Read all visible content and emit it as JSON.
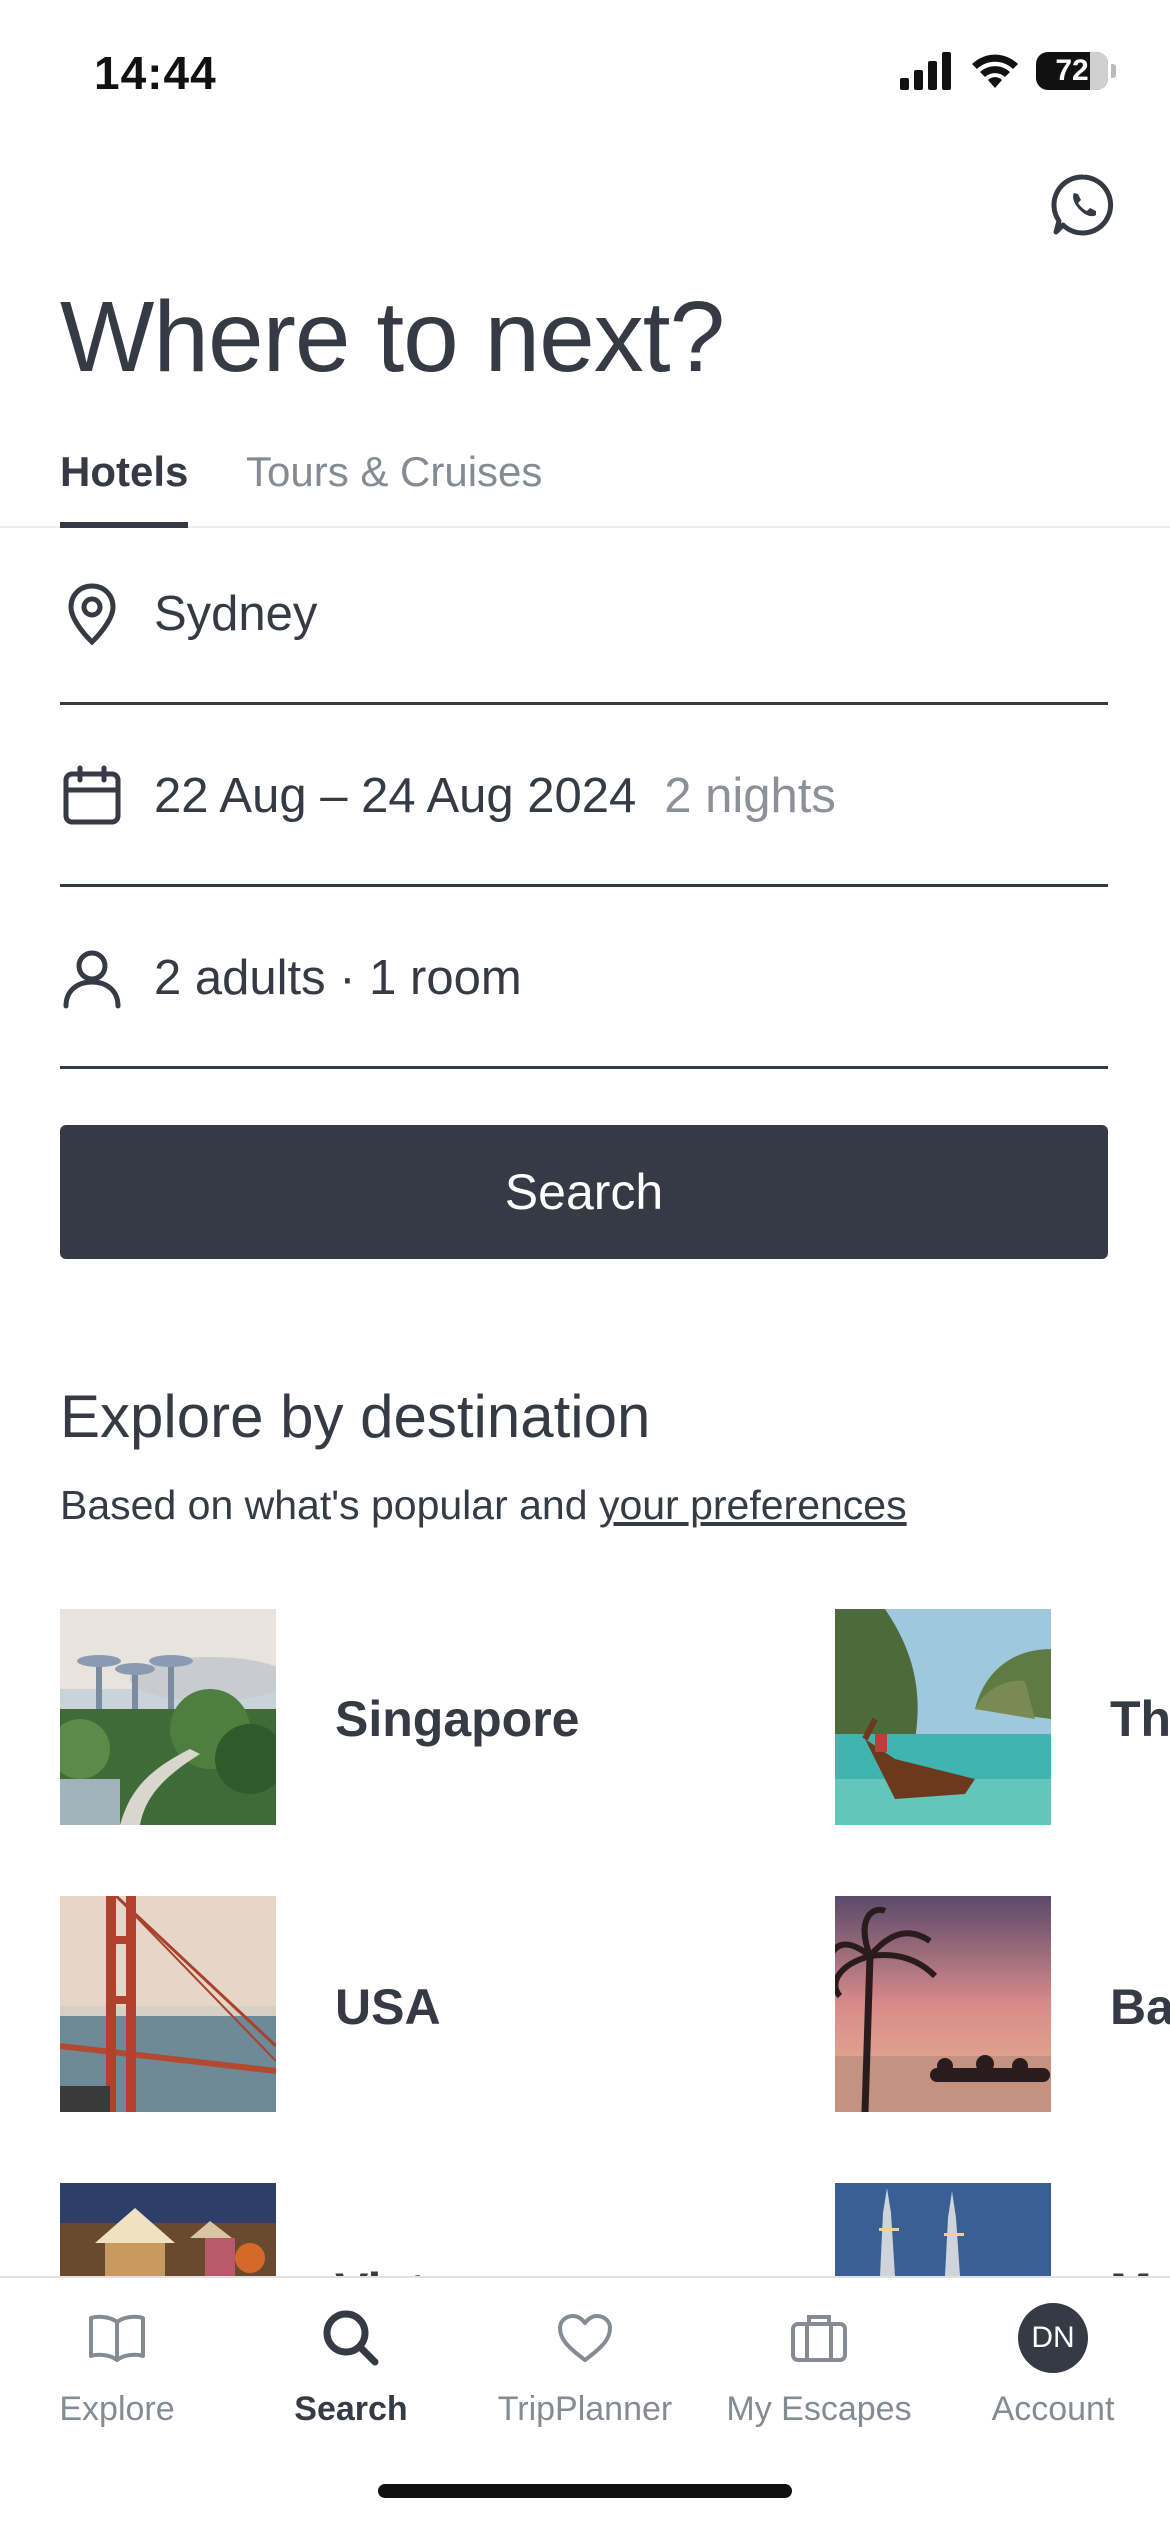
{
  "status_bar": {
    "time": "14:44",
    "battery": "72"
  },
  "header": {
    "title": "Where to next?"
  },
  "tabs": [
    {
      "label": "Hotels",
      "active": true
    },
    {
      "label": "Tours & Cruises",
      "active": false
    }
  ],
  "search_form": {
    "destination": "Sydney",
    "dates": "22 Aug – 24 Aug 2024",
    "nights": "2 nights",
    "guests": "2 adults · 1 room",
    "search_label": "Search"
  },
  "explore": {
    "title": "Explore by destination",
    "subtitle_prefix": "Based on what's popular and ",
    "subtitle_link": "your preferences",
    "destinations": [
      {
        "name": "Singapore"
      },
      {
        "name": "Th"
      },
      {
        "name": "USA"
      },
      {
        "name": "Ba"
      },
      {
        "name": "Viet"
      },
      {
        "name": "M"
      }
    ]
  },
  "bottom_nav": [
    {
      "label": "Explore",
      "icon": "book-icon"
    },
    {
      "label": "Search",
      "icon": "search-icon",
      "active": true
    },
    {
      "label": "TripPlanner",
      "icon": "heart-icon"
    },
    {
      "label": "My Escapes",
      "icon": "suitcase-icon"
    },
    {
      "label": "Account",
      "icon": "avatar",
      "initials": "DN"
    }
  ],
  "colors": {
    "primary": "#363a45",
    "muted": "#868a93"
  }
}
